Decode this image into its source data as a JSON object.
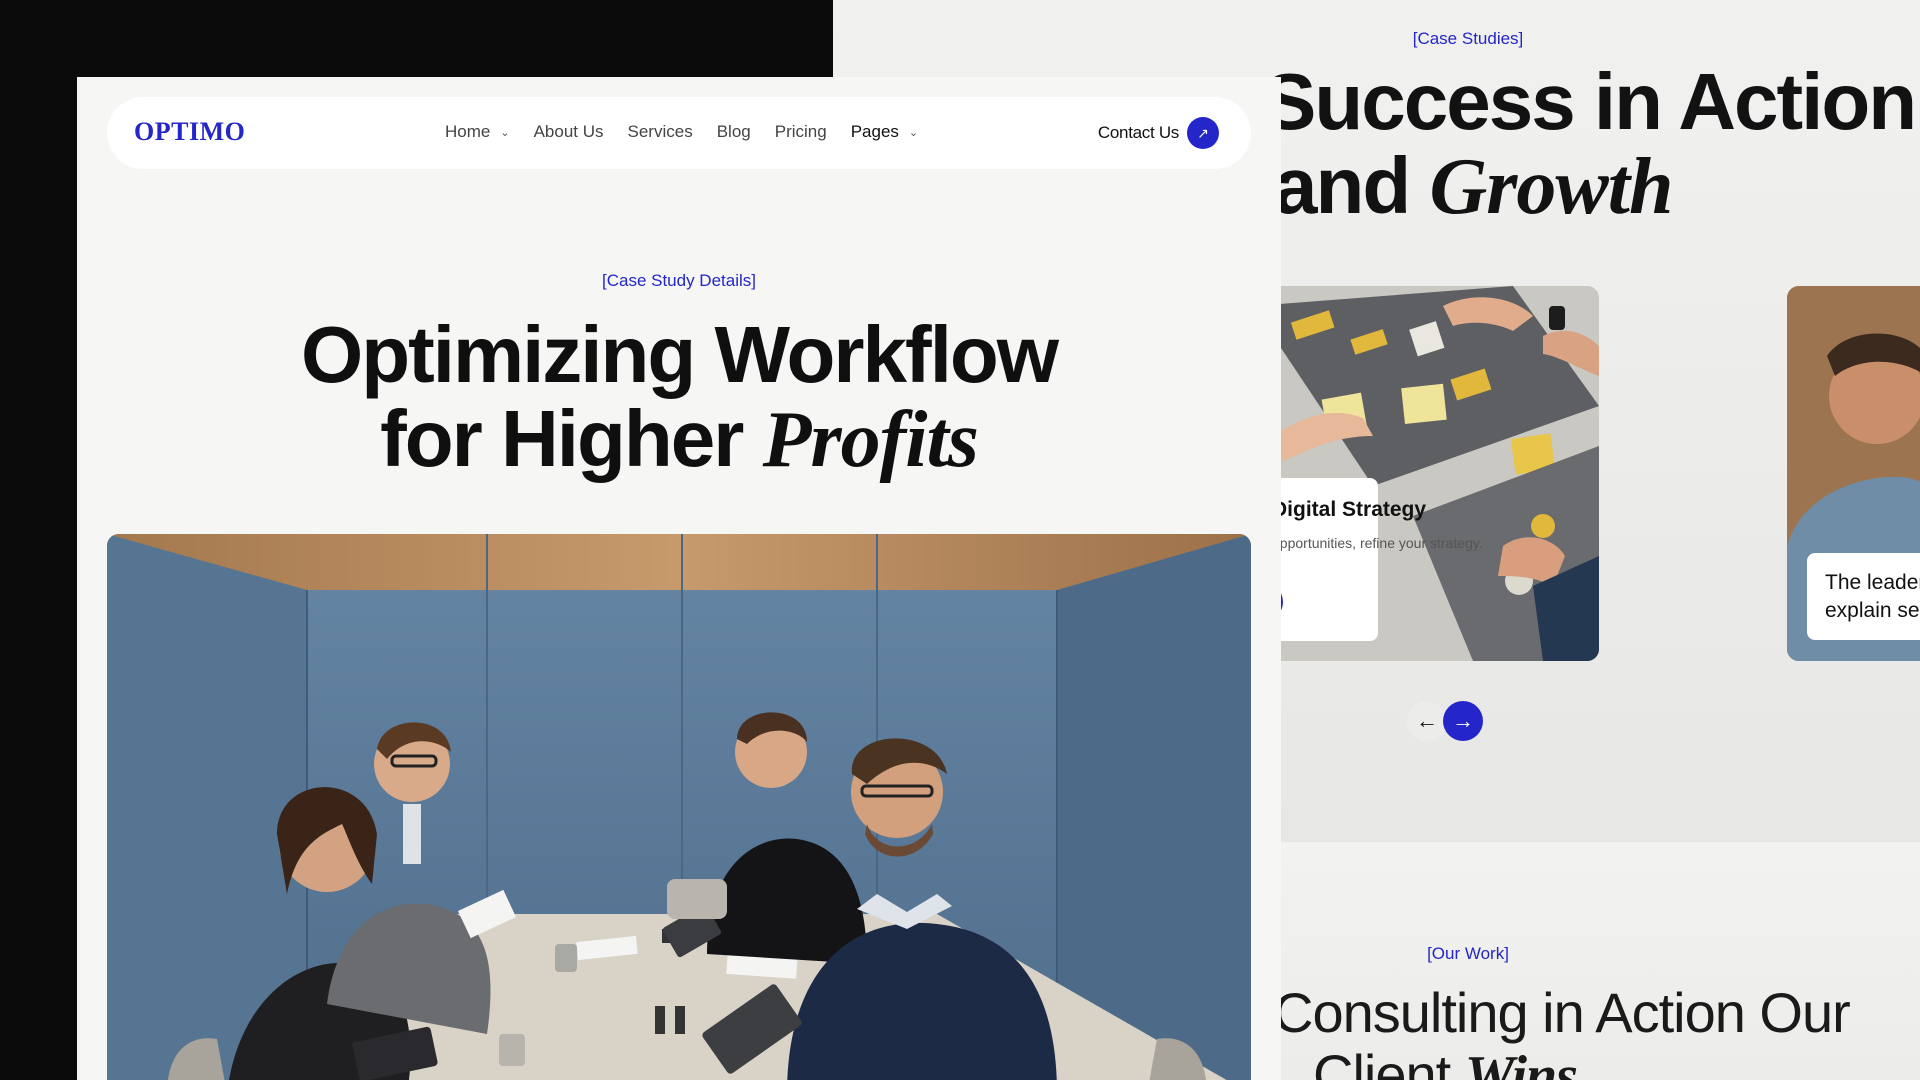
{
  "background_page": {
    "eyebrow": "[Case Studies]",
    "heading_line1": "Success in Action",
    "heading_line2_plain": "and",
    "heading_line2_italic": "Growth",
    "card": {
      "title": "New Digital Strategy",
      "text": "Growth opportunities, refine your strategy.",
      "button_label": "s",
      "button_icon": "arrow-up-right-icon"
    },
    "card2_quote_line1": "The leader",
    "card2_quote_line2": "explain ser",
    "prev_icon": "←",
    "next_icon": "→",
    "section2": {
      "eyebrow": "[Our Work]",
      "heading_line1": "Consulting in Action Our",
      "heading_line2_plain": "Client",
      "heading_line2_italic": "Wins"
    }
  },
  "navbar": {
    "logo": "OPTIMO",
    "items": [
      {
        "label": "Home",
        "has_dropdown": true
      },
      {
        "label": "About Us",
        "has_dropdown": false
      },
      {
        "label": "Services",
        "has_dropdown": false
      },
      {
        "label": "Blog",
        "has_dropdown": false
      },
      {
        "label": "Pricing",
        "has_dropdown": false
      },
      {
        "label": "Pages",
        "has_dropdown": true
      }
    ],
    "chevron": "⌄",
    "contact_label": "Contact Us",
    "contact_icon": "↗"
  },
  "hero": {
    "eyebrow": "[Case Study Details]",
    "title_line1": "Optimizing Workflow",
    "title_line2_plain": "for Higher",
    "title_line2_italic": "Profits"
  },
  "colors": {
    "accent": "#2426c9",
    "page_bg": "#f6f6f4",
    "dark_bg": "#0b0b0b"
  }
}
